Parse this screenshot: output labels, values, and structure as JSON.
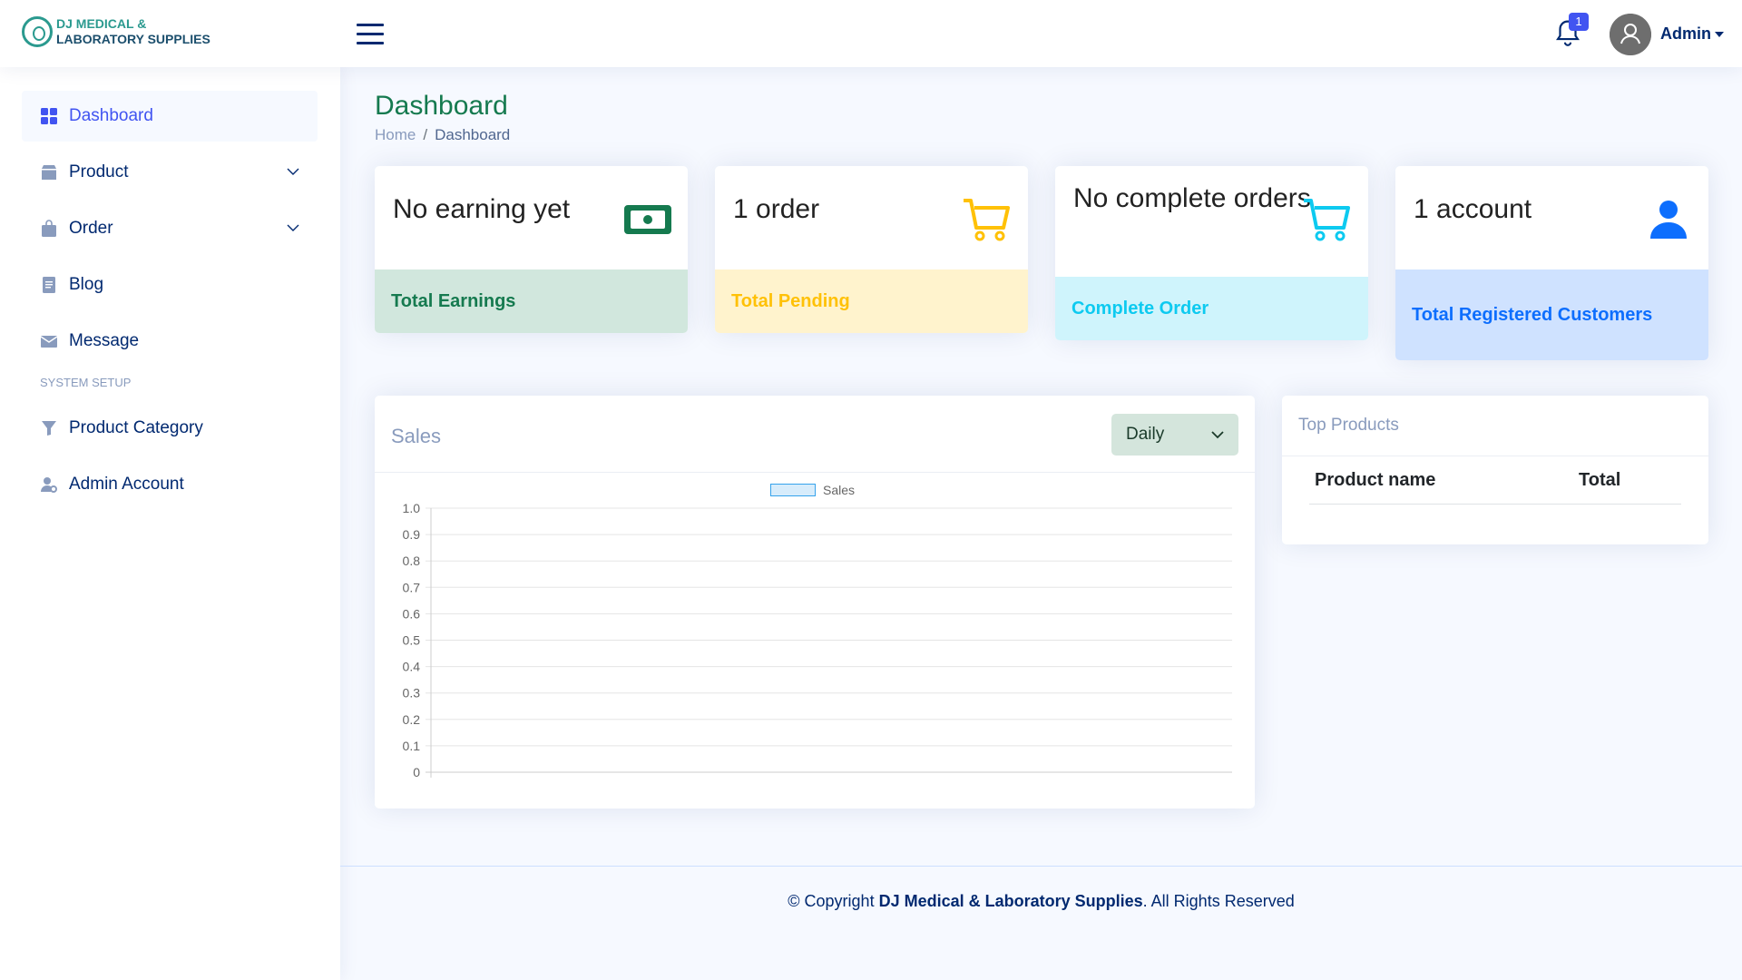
{
  "header": {
    "logo_line1": "DJ MEDICAL &",
    "logo_line2": "LABORATORY SUPPLIES",
    "notification_count": "1",
    "user_name": "Admin"
  },
  "sidebar": {
    "items": [
      {
        "label": "Dashboard",
        "icon": "grid-icon",
        "active": true
      },
      {
        "label": "Product",
        "icon": "box-icon",
        "has_children": true
      },
      {
        "label": "Order",
        "icon": "bag-icon",
        "has_children": true
      },
      {
        "label": "Blog",
        "icon": "document-icon"
      },
      {
        "label": "Message",
        "icon": "envelope-icon"
      }
    ],
    "section_heading": "SYSTEM SETUP",
    "setup_items": [
      {
        "label": "Product Category",
        "icon": "funnel-icon"
      },
      {
        "label": "Admin Account",
        "icon": "user-gear-icon"
      }
    ]
  },
  "page": {
    "title": "Dashboard",
    "breadcrumb": [
      "Home",
      "Dashboard"
    ]
  },
  "stats": [
    {
      "value": "No earning yet",
      "label": "Total Earnings",
      "icon": "cash-icon",
      "color": "#157a4f",
      "footer_bg": "#d1e7dd"
    },
    {
      "value": "1 order",
      "label": "Total Pending",
      "icon": "cart-icon",
      "color": "#ffc107",
      "footer_bg": "#fff3cd"
    },
    {
      "value": "No complete orders",
      "label": "Complete Order",
      "icon": "cart-icon",
      "color": "#0dcaf0",
      "footer_bg": "#cff4fc"
    },
    {
      "value": "1 account",
      "label": "Total Registered Customers",
      "icon": "person-icon",
      "color": "#0d6efd",
      "footer_bg": "#cfe2ff"
    }
  ],
  "sales": {
    "title": "Sales",
    "period_selected": "Daily"
  },
  "chart_data": {
    "type": "bar",
    "categories": [],
    "series": [
      {
        "name": "Sales",
        "values": []
      }
    ],
    "title": "",
    "xlabel": "",
    "ylabel": "",
    "ylim": [
      0,
      1.0
    ],
    "y_ticks": [
      "1.0",
      "0.9",
      "0.8",
      "0.7",
      "0.6",
      "0.5",
      "0.4",
      "0.3",
      "0.2",
      "0.1",
      "0"
    ],
    "grid": true,
    "legend": "top-center"
  },
  "top_products": {
    "title": "Top Products",
    "columns": [
      "Product name",
      "Total"
    ],
    "rows": []
  },
  "footer": {
    "prefix": "© Copyright ",
    "company": "DJ Medical & Laboratory Supplies",
    "suffix": ". All Rights Reserved"
  }
}
